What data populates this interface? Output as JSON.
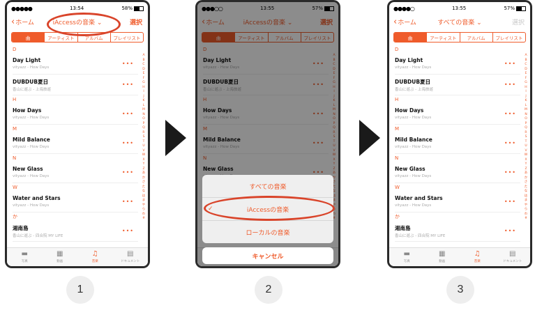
{
  "accent": "#ef5b2b",
  "steps": [
    "1",
    "2",
    "3"
  ],
  "status": {
    "phone1": {
      "time": "13:54",
      "battery": "58%"
    },
    "phone2": {
      "time": "13:55",
      "battery": "57%"
    },
    "phone3": {
      "time": "13:55",
      "battery": "57%"
    }
  },
  "nav": {
    "back_label": "ホーム",
    "title_iaccess": "iAccessの音楽",
    "title_all": "すべての音楽",
    "select_label": "選択"
  },
  "segments": [
    "曲",
    "アーティスト",
    "アルバム",
    "プレイリスト"
  ],
  "index_letters": [
    "A",
    "B",
    "C",
    "D",
    "E",
    "F",
    "G",
    "H",
    "I",
    "J",
    "K",
    "L",
    "M",
    "N",
    "O",
    "P",
    "Q",
    "R",
    "S",
    "T",
    "U",
    "V",
    "W",
    "X",
    "Y",
    "Z",
    "あ",
    "か",
    "さ",
    "た",
    "な",
    "は",
    "ま",
    "や",
    "ら",
    "わ",
    "#"
  ],
  "sections": [
    {
      "header": "D",
      "songs": [
        {
          "title": "Day Light",
          "subtitle": "vityazz - How Days"
        },
        {
          "title": "DUBDUB夏日",
          "subtitle": "香山に遊ぶ - 上海旅遊"
        }
      ]
    },
    {
      "header": "H",
      "songs": [
        {
          "title": "How Days",
          "subtitle": "vityazz - How Days"
        }
      ]
    },
    {
      "header": "M",
      "songs": [
        {
          "title": "Mild Balance",
          "subtitle": "vityazz - How Days"
        }
      ]
    },
    {
      "header": "N",
      "songs": [
        {
          "title": "New Glass",
          "subtitle": "vityazz - How Days"
        }
      ]
    },
    {
      "header": "W",
      "songs": [
        {
          "title": "Water and Stars",
          "subtitle": "vityazz - How Days"
        }
      ]
    },
    {
      "header": "か",
      "songs": [
        {
          "title": "湘南島",
          "subtitle": "香山に遊ぶ - 四合院 MY LIFE"
        }
      ]
    }
  ],
  "more_label": "•••",
  "tabs": [
    {
      "label": "写真",
      "icon": "photo-icon"
    },
    {
      "label": "動画",
      "icon": "video-icon"
    },
    {
      "label": "音楽",
      "icon": "music-note-icon"
    },
    {
      "label": "ドキュメント",
      "icon": "document-icon"
    }
  ],
  "action_sheet": {
    "options": [
      "すべての音楽",
      "iAccessの音楽",
      "ローカルの音楽"
    ],
    "selected_index": 1,
    "check": "✓",
    "cancel_label": "キャンセル"
  }
}
